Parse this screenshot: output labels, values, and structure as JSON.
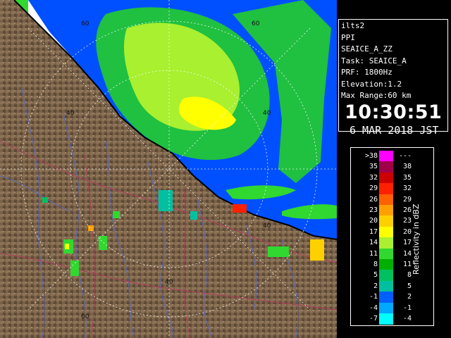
{
  "info_panel": {
    "station": "ilts2",
    "mode": "PPI",
    "product": "SEAICE_A_ZZ",
    "task": "Task: SEAICE_A",
    "prf": "PRF: 1800Hz",
    "elevation": "Elevation:1.2",
    "max_range": "Max Range:60 km",
    "time": "10:30:51",
    "date": "6 MAR 2018 JST"
  },
  "legend": {
    "title": "Reflectivity in dBZ",
    "bins": [
      {
        "min": ">38",
        "max": "---",
        "color": "#ff00ff"
      },
      {
        "min": "35",
        "max": "38",
        "color": "#a0004a"
      },
      {
        "min": "32",
        "max": "35",
        "color": "#cc0000"
      },
      {
        "min": "29",
        "max": "32",
        "color": "#ff2000"
      },
      {
        "min": "26",
        "max": "29",
        "color": "#ff6000"
      },
      {
        "min": "23",
        "max": "26",
        "color": "#ffa000"
      },
      {
        "min": "20",
        "max": "23",
        "color": "#ffd000"
      },
      {
        "min": "17",
        "max": "20",
        "color": "#ffff00"
      },
      {
        "min": "14",
        "max": "17",
        "color": "#a8f030"
      },
      {
        "min": "11",
        "max": "14",
        "color": "#30d830"
      },
      {
        "min": "8",
        "max": "11",
        "color": "#00b000"
      },
      {
        "min": "5",
        "max": "8",
        "color": "#00c060"
      },
      {
        "min": "2",
        "max": "5",
        "color": "#00c0a0"
      },
      {
        "min": "-1",
        "max": "2",
        "color": "#0060ff"
      },
      {
        "min": "-4",
        "max": "-1",
        "color": "#00a8ff"
      },
      {
        "min": "-7",
        "max": "-4",
        "color": "#00ffff"
      }
    ]
  },
  "map": {
    "range_ring_labels": [
      "60",
      "60",
      "40",
      "40",
      "40",
      "40",
      "60"
    ],
    "colors": {
      "land": "#7a6248",
      "coast": "#000000",
      "rivers": "#5a68b8",
      "roads": "#b04060",
      "grid": "#ffffff",
      "sea_echo": "#0050ff"
    }
  }
}
